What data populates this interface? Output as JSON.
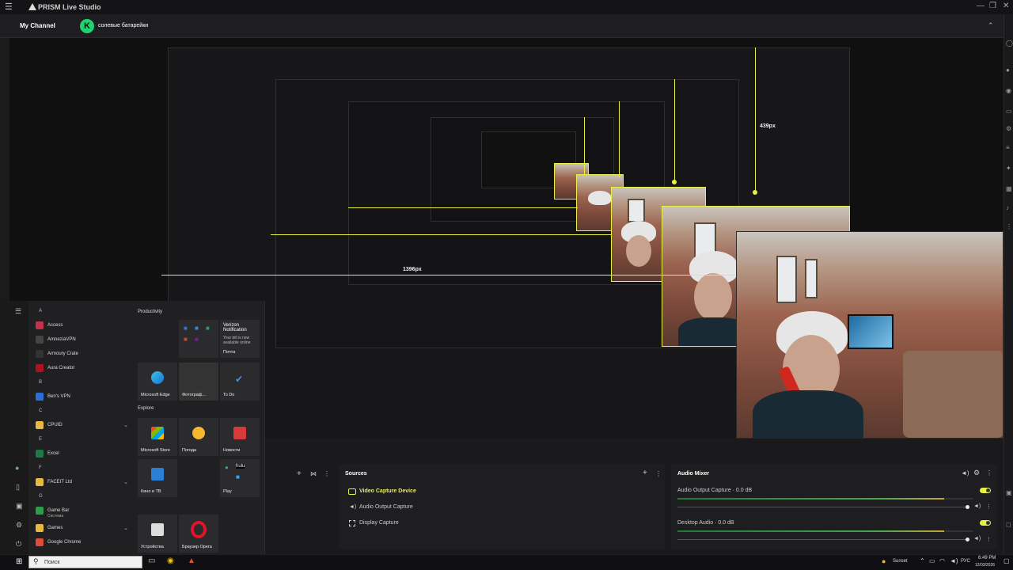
{
  "app": {
    "title": "PRISM Live Studio",
    "channel_label": "My Channel",
    "channel_name": "солевые батарейки",
    "avatar_letter": "K"
  },
  "preview": {
    "recursive_labels": {
      "width_label": "1396px",
      "height_label": "439px"
    }
  },
  "sources": {
    "title": "Sources",
    "items": [
      {
        "label": "Video Capture Device",
        "active": true
      },
      {
        "label": "Audio Output Capture",
        "active": false
      },
      {
        "label": "Display Capture",
        "active": false
      }
    ]
  },
  "mixer": {
    "title": "Audio Mixer",
    "channels": [
      {
        "label": "Audio Output Capture · 0.0 dB",
        "level": 0.9
      },
      {
        "label": "Desktop Audio · 0.0 dB",
        "level": 0.9
      }
    ]
  },
  "start_menu": {
    "groups": {
      "productivity": "Productivity",
      "explore": "Explore"
    },
    "apps": [
      {
        "type": "letter",
        "text": "A"
      },
      {
        "type": "app",
        "text": "Access",
        "color": "#c4314b"
      },
      {
        "type": "app",
        "text": "AmneziaVPN",
        "color": "#444"
      },
      {
        "type": "app",
        "text": "Armoury Crate",
        "color": "#333"
      },
      {
        "type": "app",
        "text": "Aura Creator",
        "color": "#b01020"
      },
      {
        "type": "letter",
        "text": "B"
      },
      {
        "type": "app",
        "text": "Ben's VPN",
        "color": "#2a6fd6"
      },
      {
        "type": "letter",
        "text": "C"
      },
      {
        "type": "folder",
        "text": "CPUID",
        "color": "#e9b840"
      },
      {
        "type": "letter",
        "text": "E"
      },
      {
        "type": "app",
        "text": "Excel",
        "color": "#1d7a44"
      },
      {
        "type": "letter",
        "text": "F"
      },
      {
        "type": "folder",
        "text": "FACEIT Ltd",
        "color": "#e9b840"
      },
      {
        "type": "letter",
        "text": "G"
      },
      {
        "type": "app2",
        "text": "Game Bar",
        "sub": "Система",
        "color": "#2a9d4a"
      },
      {
        "type": "folder",
        "text": "Games",
        "color": "#e9b840"
      },
      {
        "type": "app",
        "text": "Google Chrome",
        "color": "#e04b3a"
      }
    ],
    "tiles": {
      "verizon_title": "Verizon Notification",
      "verizon_body": "Your bill is now available online",
      "mail": "Почта",
      "edge": "Microsoft Edge",
      "photos": "Фотограф...",
      "todo": "To Do",
      "store": "Microsoft Store",
      "weather": "Погода",
      "news": "Новости",
      "movies": "Кино и ТВ",
      "play": "Play",
      "devices": "Устройства",
      "opera": "Браузер Opera"
    }
  },
  "taskbar": {
    "search_placeholder": "Поиск",
    "weather": "Sunset",
    "lang": "РУС",
    "time": "6:49 PM",
    "date": "12/03/2026"
  },
  "colors": {
    "accent": "#e8f046",
    "avatar": "#1fd36e"
  }
}
